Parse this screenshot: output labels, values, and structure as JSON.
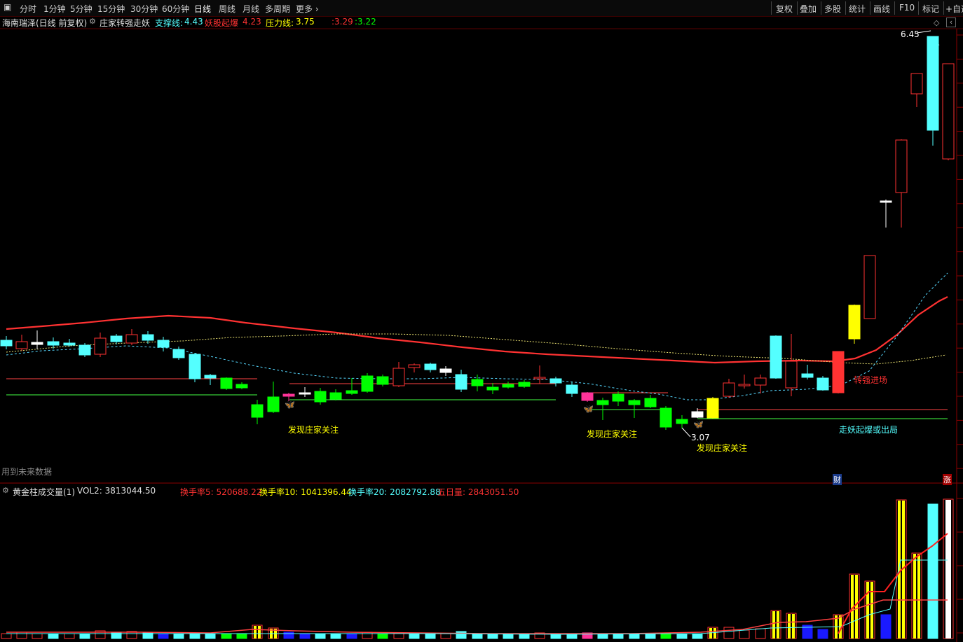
{
  "toolbar": {
    "period_tabs": [
      "分时",
      "1分钟",
      "5分钟",
      "15分钟",
      "30分钟",
      "60分钟",
      "日线",
      "周线",
      "月线",
      "多周期",
      "更多"
    ],
    "right_buttons": [
      "复权",
      "叠加",
      "多股",
      "统计",
      "画线",
      "F10",
      "标记",
      "+自选"
    ]
  },
  "main_info": {
    "stock_name": "海南瑞泽(日线 前复权)",
    "indicator_name": "庄家转强走妖",
    "support_label": "支撑线:",
    "support_value": "4.43",
    "yaojiu_label": "妖股起爆",
    "yaojiu_value": "4.23",
    "pressure_label": "压力线:",
    "pressure_value": "3.75",
    "extra1": ":3.29",
    "extra2": ":3.22"
  },
  "annotations": {
    "high_price": "6.45",
    "low_price": "3.07",
    "label_focus_1": "发现庄家关注",
    "label_focus_2": "发现庄家关注",
    "label_focus_3": "发现庄家关注",
    "label_strong": "转强进场",
    "label_exit": "走妖起爆或出局",
    "future_data": "用到未来数据",
    "badge_cai": "财",
    "badge_zhang": "涨"
  },
  "volume_info": {
    "indicator_name": "黄金柱成交量(1)",
    "vol2": "VOL2: 3813044.50",
    "hs5": "换手率5: 520688.22",
    "hs10": "换手率10: 1041396.44",
    "hs20": "换手率20: 2082792.88",
    "wuri": "五日量: 2843051.50"
  },
  "colors": {
    "up": "#ff3232",
    "down_cyan": "#54ffff",
    "green": "#00ff00",
    "yellow": "#ffff00",
    "magenta": "#ff3399",
    "background": "#000000"
  }
}
